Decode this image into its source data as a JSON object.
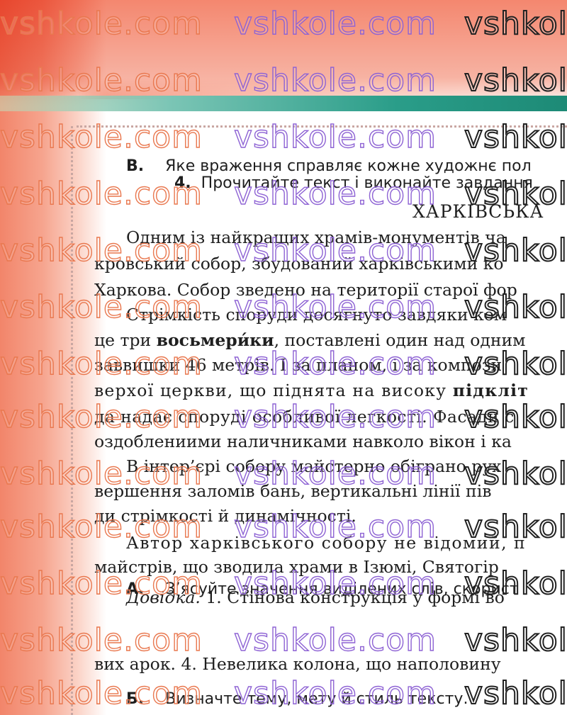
{
  "watermark": "vshkole.com",
  "question_v": {
    "letter": "В.",
    "text": "Яке враження справляє кожне художнє пол"
  },
  "task4": {
    "number": "4.",
    "text": "Прочитайте текст і виконайте завдання"
  },
  "title": "ХАРКІВСЬКА",
  "body": [
    [
      {
        "t": "Одним із найкращих храмів-монументів ча"
      }
    ],
    [
      {
        "t": "кровський собор, збудований харківськими ко"
      }
    ],
    [
      {
        "t": "Харкова. Собор зведено на території старої фор"
      }
    ],
    [
      {
        "t": "Стрімкість споруди досягнуто завдяки ком"
      }
    ],
    [
      {
        "t": "це три "
      },
      {
        "t": "восьмери́ки",
        "b": true
      },
      {
        "t": ", поставлені один над одним"
      }
    ],
    [
      {
        "t": "заввишки 46 метрів. І за планом, і за компози"
      }
    ],
    [
      {
        "t": "верхої церкви, що піднята на високу "
      },
      {
        "t": "підкліт",
        "b": true
      }
    ],
    [
      {
        "t": "да надає споруді особливої легкості. Фасади с"
      }
    ],
    [
      {
        "t": "оздоблениими наличниками навколо вікон і ка"
      }
    ],
    [
      {
        "t": "В інтер’єрі собору майстерно обіграно рух"
      }
    ],
    [
      {
        "t": "вершення заломів бань, вертикальні лінії пів"
      }
    ],
    [
      {
        "t": "ди стрімкості й динамічності."
      }
    ],
    [
      {
        "t": "Автор харківського собору не відомий, п"
      }
    ],
    [
      {
        "t": "майстрів, що зводила храми в Ізюмі, Святогір"
      }
    ]
  ],
  "task_a": {
    "letter": "А.",
    "text": "З’ясуйте значення виділених слів, скорист"
  },
  "dovidka": {
    "label": "Довідка.",
    "text": " 1. Стінова конструкція у формі во"
  },
  "dovidka_cont": "вих арок. 4. Невелика колона, що наполовину",
  "task_b": {
    "letter": "Б.",
    "text": "Визначте тему, мету й стиль тексту."
  }
}
